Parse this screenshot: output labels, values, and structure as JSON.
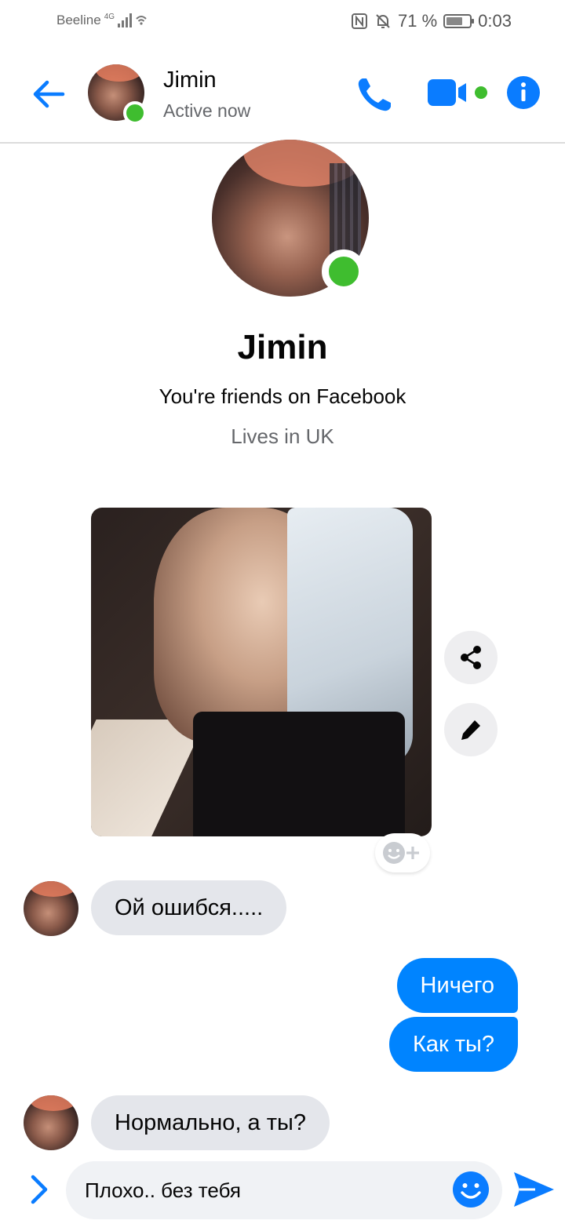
{
  "status_bar": {
    "carrier": "Beeline",
    "network": "4G",
    "battery": "71 %",
    "battery_level": 0.71,
    "time": "0:03"
  },
  "header": {
    "contact_name": "Jimin",
    "contact_status": "Active now"
  },
  "profile": {
    "name": "Jimin",
    "friends_text": "You're friends on Facebook",
    "lives_text": "Lives in UK"
  },
  "messages": [
    {
      "direction": "incoming",
      "text": "Ой ошибся....."
    },
    {
      "direction": "outgoing",
      "text": "Ничего"
    },
    {
      "direction": "outgoing",
      "text": "Как ты?"
    },
    {
      "direction": "incoming",
      "text": "Нормально, а ты?"
    }
  ],
  "composer": {
    "value": "Плохо.. без тебя"
  },
  "colors": {
    "accent": "#0084ff",
    "online": "#3fbd2f",
    "incoming_bubble": "#e4e6eb"
  },
  "icons": [
    "back-arrow-icon",
    "phone-icon",
    "video-camera-icon",
    "info-icon",
    "share-icon",
    "pencil-icon",
    "add-reaction-icon",
    "chevron-right-icon",
    "emoji-icon",
    "send-icon"
  ]
}
